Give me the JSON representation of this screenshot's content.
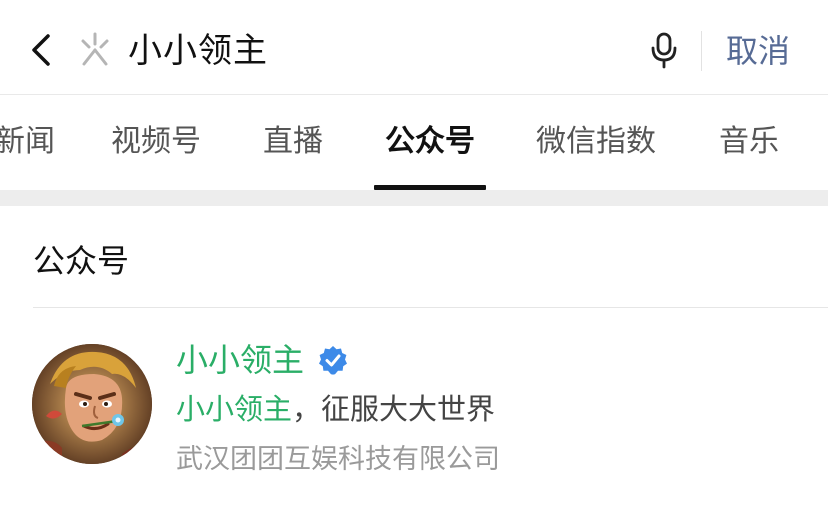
{
  "search": {
    "query": "小小领主",
    "cancel_label": "取消"
  },
  "tabs": [
    {
      "label": "新闻"
    },
    {
      "label": "视频号"
    },
    {
      "label": "直播"
    },
    {
      "label": "公众号",
      "active": true
    },
    {
      "label": "微信指数"
    },
    {
      "label": "音乐"
    }
  ],
  "section": {
    "title": "公众号"
  },
  "result": {
    "name": "小小领主",
    "verified": true,
    "desc_highlight": "小小领主",
    "desc_rest": "，征服大大世界",
    "company": "武汉团团互娱科技有限公司"
  },
  "colors": {
    "highlight": "#2aae67",
    "link": "#576b95",
    "verified": "#3d8ae8"
  },
  "icons": [
    "back-arrow-icon",
    "wechat-search-logo-icon",
    "microphone-icon",
    "verified-badge-icon"
  ]
}
